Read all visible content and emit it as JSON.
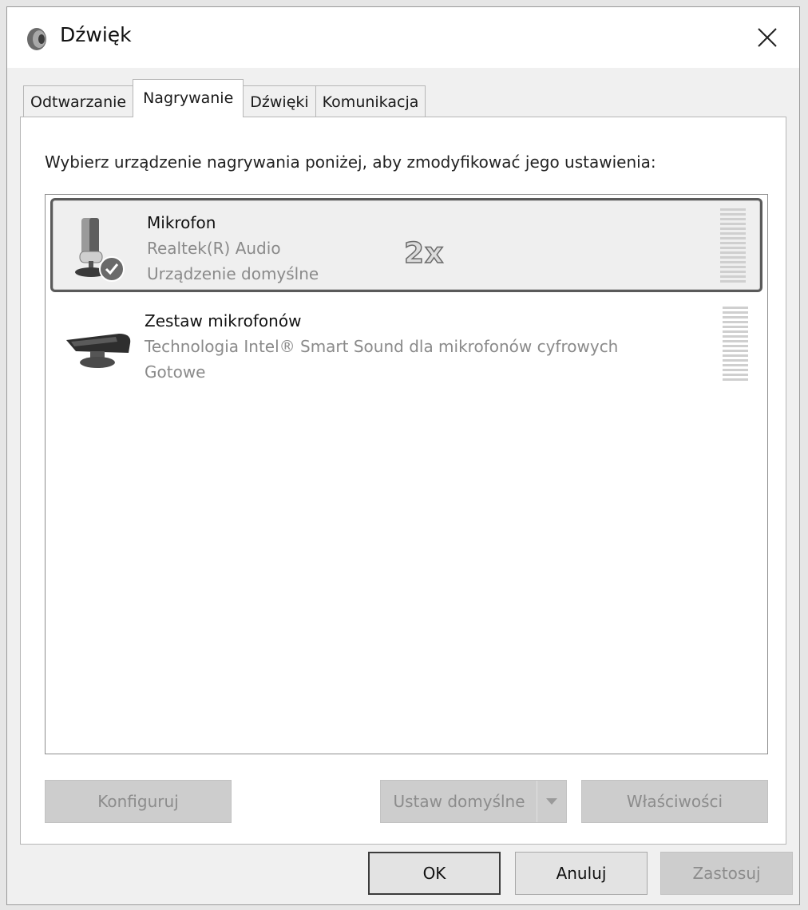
{
  "window": {
    "title": "Dźwięk",
    "icon": "speaker-icon",
    "close_icon": "close-icon"
  },
  "tabs": [
    {
      "label": "Odtwarzanie",
      "active": false
    },
    {
      "label": "Nagrywanie",
      "active": true
    },
    {
      "label": "Dźwięki",
      "active": false
    },
    {
      "label": "Komunikacja",
      "active": false
    }
  ],
  "panel": {
    "instruction": "Wybierz urządzenie nagrywania poniżej, aby zmodyfikować jego ustawienia:"
  },
  "devices": [
    {
      "name": "Mikrofon",
      "driver": "Realtek(R) Audio",
      "status": "Urządzenie domyślne",
      "icon": "microphone-icon",
      "badge_icon": "default-check-icon",
      "selected": true,
      "annotation": "2x"
    },
    {
      "name": "Zestaw mikrofonów",
      "driver": "Technologia Intel® Smart Sound dla mikrofonów cyfrowych",
      "status": "Gotowe",
      "icon": "microphone-array-icon",
      "selected": false
    }
  ],
  "buttons": {
    "configure": "Konfiguruj",
    "set_default": "Ustaw domyślne",
    "properties": "Właściwości",
    "ok": "OK",
    "cancel": "Anuluj",
    "apply": "Zastosuj"
  },
  "colors": {
    "selection_border": "#5a5a5a",
    "disabled_button": "#cdcdcd",
    "panel_bg": "#ffffff"
  }
}
